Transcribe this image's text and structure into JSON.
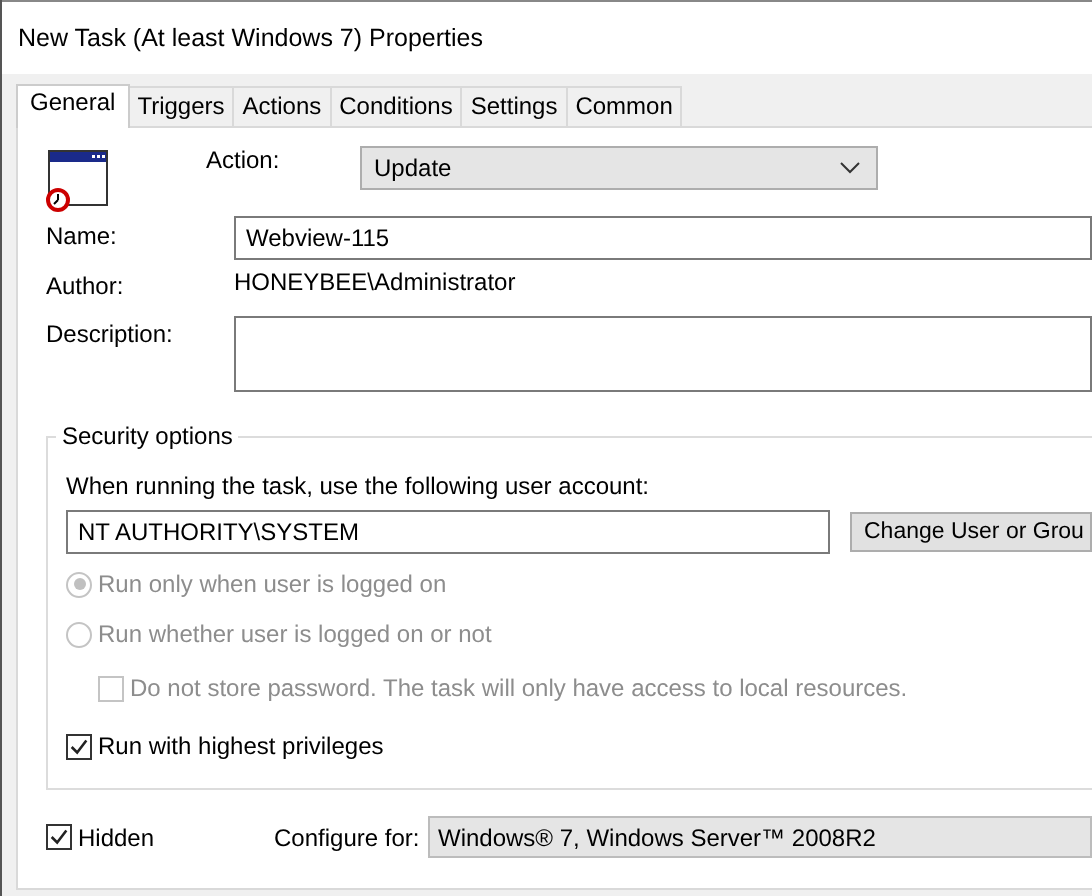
{
  "window": {
    "title": "New Task (At least Windows 7) Properties"
  },
  "tabs": [
    {
      "label": "General",
      "selected": true
    },
    {
      "label": "Triggers",
      "selected": false
    },
    {
      "label": "Actions",
      "selected": false
    },
    {
      "label": "Conditions",
      "selected": false
    },
    {
      "label": "Settings",
      "selected": false
    },
    {
      "label": "Common",
      "selected": false
    }
  ],
  "action": {
    "label": "Action:",
    "value": "Update"
  },
  "name": {
    "label": "Name:",
    "value": "Webview-115"
  },
  "author": {
    "label": "Author:",
    "value": "HONEYBEE\\Administrator"
  },
  "description": {
    "label": "Description:"
  },
  "security": {
    "legend": "Security options",
    "account_label": "When running the task, use the following user account:",
    "account": "NT AUTHORITY\\SYSTEM",
    "change_button": "Change User or Grou",
    "radios": [
      {
        "label": "Run only when user is logged on",
        "selected": true,
        "disabled": true
      },
      {
        "label": "Run whether user is logged on or not",
        "selected": false,
        "disabled": true
      }
    ],
    "no_password": {
      "label": "Do not store password. The task will only have access to local resources.",
      "checked": false,
      "disabled": true
    },
    "highest": {
      "label": "Run with highest privileges",
      "checked": true
    }
  },
  "hidden": {
    "label": "Hidden",
    "checked": true
  },
  "configure": {
    "label": "Configure for:",
    "value": "Windows® 7, Windows Server™ 2008R2"
  }
}
